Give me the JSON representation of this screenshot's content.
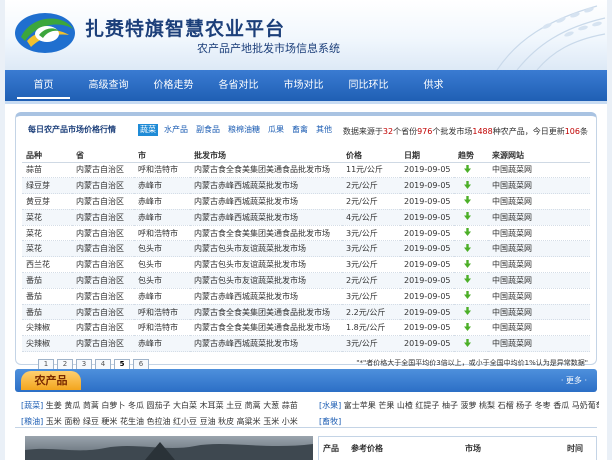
{
  "site": {
    "title": "扎赉特旗智慧农业平台",
    "subtitle": "农产品产地批发市场信息系统"
  },
  "nav": [
    "首页",
    "高级查询",
    "价格走势",
    "各省对比",
    "市场对比",
    "同比环比",
    "供求"
  ],
  "panel": {
    "title": "每日农产品市场价格行情",
    "categories": [
      "蔬菜",
      "水产品",
      "副食品",
      "粮棉油糖",
      "瓜果",
      "畜禽",
      "其他"
    ],
    "stats": {
      "prefix": "数据来源于",
      "provinces": "32",
      "mid1": "个省份",
      "markets": "976",
      "mid2": "个批发市场",
      "products": "1488",
      "mid3": "种农产品，今日更新",
      "updated": "106",
      "suffix": "条"
    },
    "columns": [
      "品种",
      "省",
      "市",
      "批发市场",
      "价格",
      "日期",
      "趋势",
      "来源网站"
    ],
    "rows": [
      [
        "蒜苗",
        "内蒙古自治区",
        "呼和浩特市",
        "内蒙古食全食美集团美通食品批发市场",
        "11元/公斤",
        "2019-09-05",
        "中国蔬菜网"
      ],
      [
        "绿豆芽",
        "内蒙古自治区",
        "赤峰市",
        "内蒙古赤峰西城蔬菜批发市场",
        "2元/公斤",
        "2019-09-05",
        "中国蔬菜网"
      ],
      [
        "黄豆芽",
        "内蒙古自治区",
        "赤峰市",
        "内蒙古赤峰西城蔬菜批发市场",
        "2元/公斤",
        "2019-09-05",
        "中国蔬菜网"
      ],
      [
        "菜花",
        "内蒙古自治区",
        "赤峰市",
        "内蒙古赤峰西城蔬菜批发市场",
        "4元/公斤",
        "2019-09-05",
        "中国蔬菜网"
      ],
      [
        "菜花",
        "内蒙古自治区",
        "呼和浩特市",
        "内蒙古食全食美集团美通食品批发市场",
        "3元/公斤",
        "2019-09-05",
        "中国蔬菜网"
      ],
      [
        "菜花",
        "内蒙古自治区",
        "包头市",
        "内蒙古包头市友谊蔬菜批发市场",
        "3元/公斤",
        "2019-09-05",
        "中国蔬菜网"
      ],
      [
        "西兰花",
        "内蒙古自治区",
        "包头市",
        "内蒙古包头市友谊蔬菜批发市场",
        "3元/公斤",
        "2019-09-05",
        "中国蔬菜网"
      ],
      [
        "番茄",
        "内蒙古自治区",
        "包头市",
        "内蒙古包头市友谊蔬菜批发市场",
        "2元/公斤",
        "2019-09-05",
        "中国蔬菜网"
      ],
      [
        "番茄",
        "内蒙古自治区",
        "赤峰市",
        "内蒙古赤峰西城蔬菜批发市场",
        "3元/公斤",
        "2019-09-05",
        "中国蔬菜网"
      ],
      [
        "番茄",
        "内蒙古自治区",
        "呼和浩特市",
        "内蒙古食全食美集团美通食品批发市场",
        "2.2元/公斤",
        "2019-09-05",
        "中国蔬菜网"
      ],
      [
        "尖辣椒",
        "内蒙古自治区",
        "呼和浩特市",
        "内蒙古食全食美集团美通食品批发市场",
        "1.8元/公斤",
        "2019-09-05",
        "中国蔬菜网"
      ],
      [
        "尖辣椒",
        "内蒙古自治区",
        "赤峰市",
        "内蒙古赤峰西城蔬菜批发市场",
        "3元/公斤",
        "2019-09-05",
        "中国蔬菜网"
      ]
    ],
    "pages": [
      "1",
      "2",
      "3",
      "4",
      "5",
      "6"
    ],
    "current_page": "5",
    "note": "\"*\"者价格大于全国平均价3倍以上，或小于全国中均价1%认为是异常数据\""
  },
  "farm": {
    "band_title": "农产品",
    "more": "· 更多 ·",
    "row1_left_tag": "[蔬菜]",
    "row1_left": " 生姜 黄瓜 茼蒿 白萝卜 冬瓜 圆茄子 大白菜 木耳菜 土豆 茼蒿 大葱 蒜苗",
    "row1_right_tag": "[水果]",
    "row1_right": " 富士苹果 芒果 山楂 红提子 柚子 菠萝 桃梨 石榴 杨子 冬枣 香瓜 马奶葡萄",
    "row2_left_tag": "[粮油]",
    "row2_left": " 玉米 面粉 绿豆 粳米 花生油 色拉油 红小豆 豆油 秋皮 高粱米 玉米 小米",
    "row2_right_tag": "[畜牧]",
    "row2_right": "",
    "mini_cols": [
      "产品",
      "参考价格",
      "市场",
      "时间"
    ]
  }
}
